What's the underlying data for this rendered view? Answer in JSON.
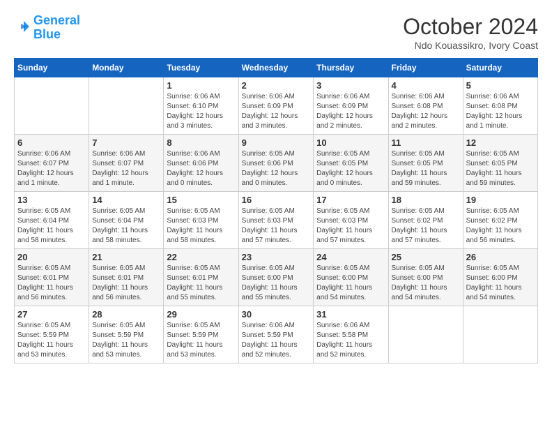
{
  "header": {
    "logo_line1": "General",
    "logo_line2": "Blue",
    "month": "October 2024",
    "location": "Ndo Kouassikro, Ivory Coast"
  },
  "weekdays": [
    "Sunday",
    "Monday",
    "Tuesday",
    "Wednesday",
    "Thursday",
    "Friday",
    "Saturday"
  ],
  "weeks": [
    [
      {
        "day": "",
        "info": ""
      },
      {
        "day": "",
        "info": ""
      },
      {
        "day": "1",
        "info": "Sunrise: 6:06 AM\nSunset: 6:10 PM\nDaylight: 12 hours and 3 minutes."
      },
      {
        "day": "2",
        "info": "Sunrise: 6:06 AM\nSunset: 6:09 PM\nDaylight: 12 hours and 3 minutes."
      },
      {
        "day": "3",
        "info": "Sunrise: 6:06 AM\nSunset: 6:09 PM\nDaylight: 12 hours and 2 minutes."
      },
      {
        "day": "4",
        "info": "Sunrise: 6:06 AM\nSunset: 6:08 PM\nDaylight: 12 hours and 2 minutes."
      },
      {
        "day": "5",
        "info": "Sunrise: 6:06 AM\nSunset: 6:08 PM\nDaylight: 12 hours and 1 minute."
      }
    ],
    [
      {
        "day": "6",
        "info": "Sunrise: 6:06 AM\nSunset: 6:07 PM\nDaylight: 12 hours and 1 minute."
      },
      {
        "day": "7",
        "info": "Sunrise: 6:06 AM\nSunset: 6:07 PM\nDaylight: 12 hours and 1 minute."
      },
      {
        "day": "8",
        "info": "Sunrise: 6:06 AM\nSunset: 6:06 PM\nDaylight: 12 hours and 0 minutes."
      },
      {
        "day": "9",
        "info": "Sunrise: 6:05 AM\nSunset: 6:06 PM\nDaylight: 12 hours and 0 minutes."
      },
      {
        "day": "10",
        "info": "Sunrise: 6:05 AM\nSunset: 6:05 PM\nDaylight: 12 hours and 0 minutes."
      },
      {
        "day": "11",
        "info": "Sunrise: 6:05 AM\nSunset: 6:05 PM\nDaylight: 11 hours and 59 minutes."
      },
      {
        "day": "12",
        "info": "Sunrise: 6:05 AM\nSunset: 6:05 PM\nDaylight: 11 hours and 59 minutes."
      }
    ],
    [
      {
        "day": "13",
        "info": "Sunrise: 6:05 AM\nSunset: 6:04 PM\nDaylight: 11 hours and 58 minutes."
      },
      {
        "day": "14",
        "info": "Sunrise: 6:05 AM\nSunset: 6:04 PM\nDaylight: 11 hours and 58 minutes."
      },
      {
        "day": "15",
        "info": "Sunrise: 6:05 AM\nSunset: 6:03 PM\nDaylight: 11 hours and 58 minutes."
      },
      {
        "day": "16",
        "info": "Sunrise: 6:05 AM\nSunset: 6:03 PM\nDaylight: 11 hours and 57 minutes."
      },
      {
        "day": "17",
        "info": "Sunrise: 6:05 AM\nSunset: 6:03 PM\nDaylight: 11 hours and 57 minutes."
      },
      {
        "day": "18",
        "info": "Sunrise: 6:05 AM\nSunset: 6:02 PM\nDaylight: 11 hours and 57 minutes."
      },
      {
        "day": "19",
        "info": "Sunrise: 6:05 AM\nSunset: 6:02 PM\nDaylight: 11 hours and 56 minutes."
      }
    ],
    [
      {
        "day": "20",
        "info": "Sunrise: 6:05 AM\nSunset: 6:01 PM\nDaylight: 11 hours and 56 minutes."
      },
      {
        "day": "21",
        "info": "Sunrise: 6:05 AM\nSunset: 6:01 PM\nDaylight: 11 hours and 56 minutes."
      },
      {
        "day": "22",
        "info": "Sunrise: 6:05 AM\nSunset: 6:01 PM\nDaylight: 11 hours and 55 minutes."
      },
      {
        "day": "23",
        "info": "Sunrise: 6:05 AM\nSunset: 6:00 PM\nDaylight: 11 hours and 55 minutes."
      },
      {
        "day": "24",
        "info": "Sunrise: 6:05 AM\nSunset: 6:00 PM\nDaylight: 11 hours and 54 minutes."
      },
      {
        "day": "25",
        "info": "Sunrise: 6:05 AM\nSunset: 6:00 PM\nDaylight: 11 hours and 54 minutes."
      },
      {
        "day": "26",
        "info": "Sunrise: 6:05 AM\nSunset: 6:00 PM\nDaylight: 11 hours and 54 minutes."
      }
    ],
    [
      {
        "day": "27",
        "info": "Sunrise: 6:05 AM\nSunset: 5:59 PM\nDaylight: 11 hours and 53 minutes."
      },
      {
        "day": "28",
        "info": "Sunrise: 6:05 AM\nSunset: 5:59 PM\nDaylight: 11 hours and 53 minutes."
      },
      {
        "day": "29",
        "info": "Sunrise: 6:05 AM\nSunset: 5:59 PM\nDaylight: 11 hours and 53 minutes."
      },
      {
        "day": "30",
        "info": "Sunrise: 6:06 AM\nSunset: 5:59 PM\nDaylight: 11 hours and 52 minutes."
      },
      {
        "day": "31",
        "info": "Sunrise: 6:06 AM\nSunset: 5:58 PM\nDaylight: 11 hours and 52 minutes."
      },
      {
        "day": "",
        "info": ""
      },
      {
        "day": "",
        "info": ""
      }
    ]
  ]
}
